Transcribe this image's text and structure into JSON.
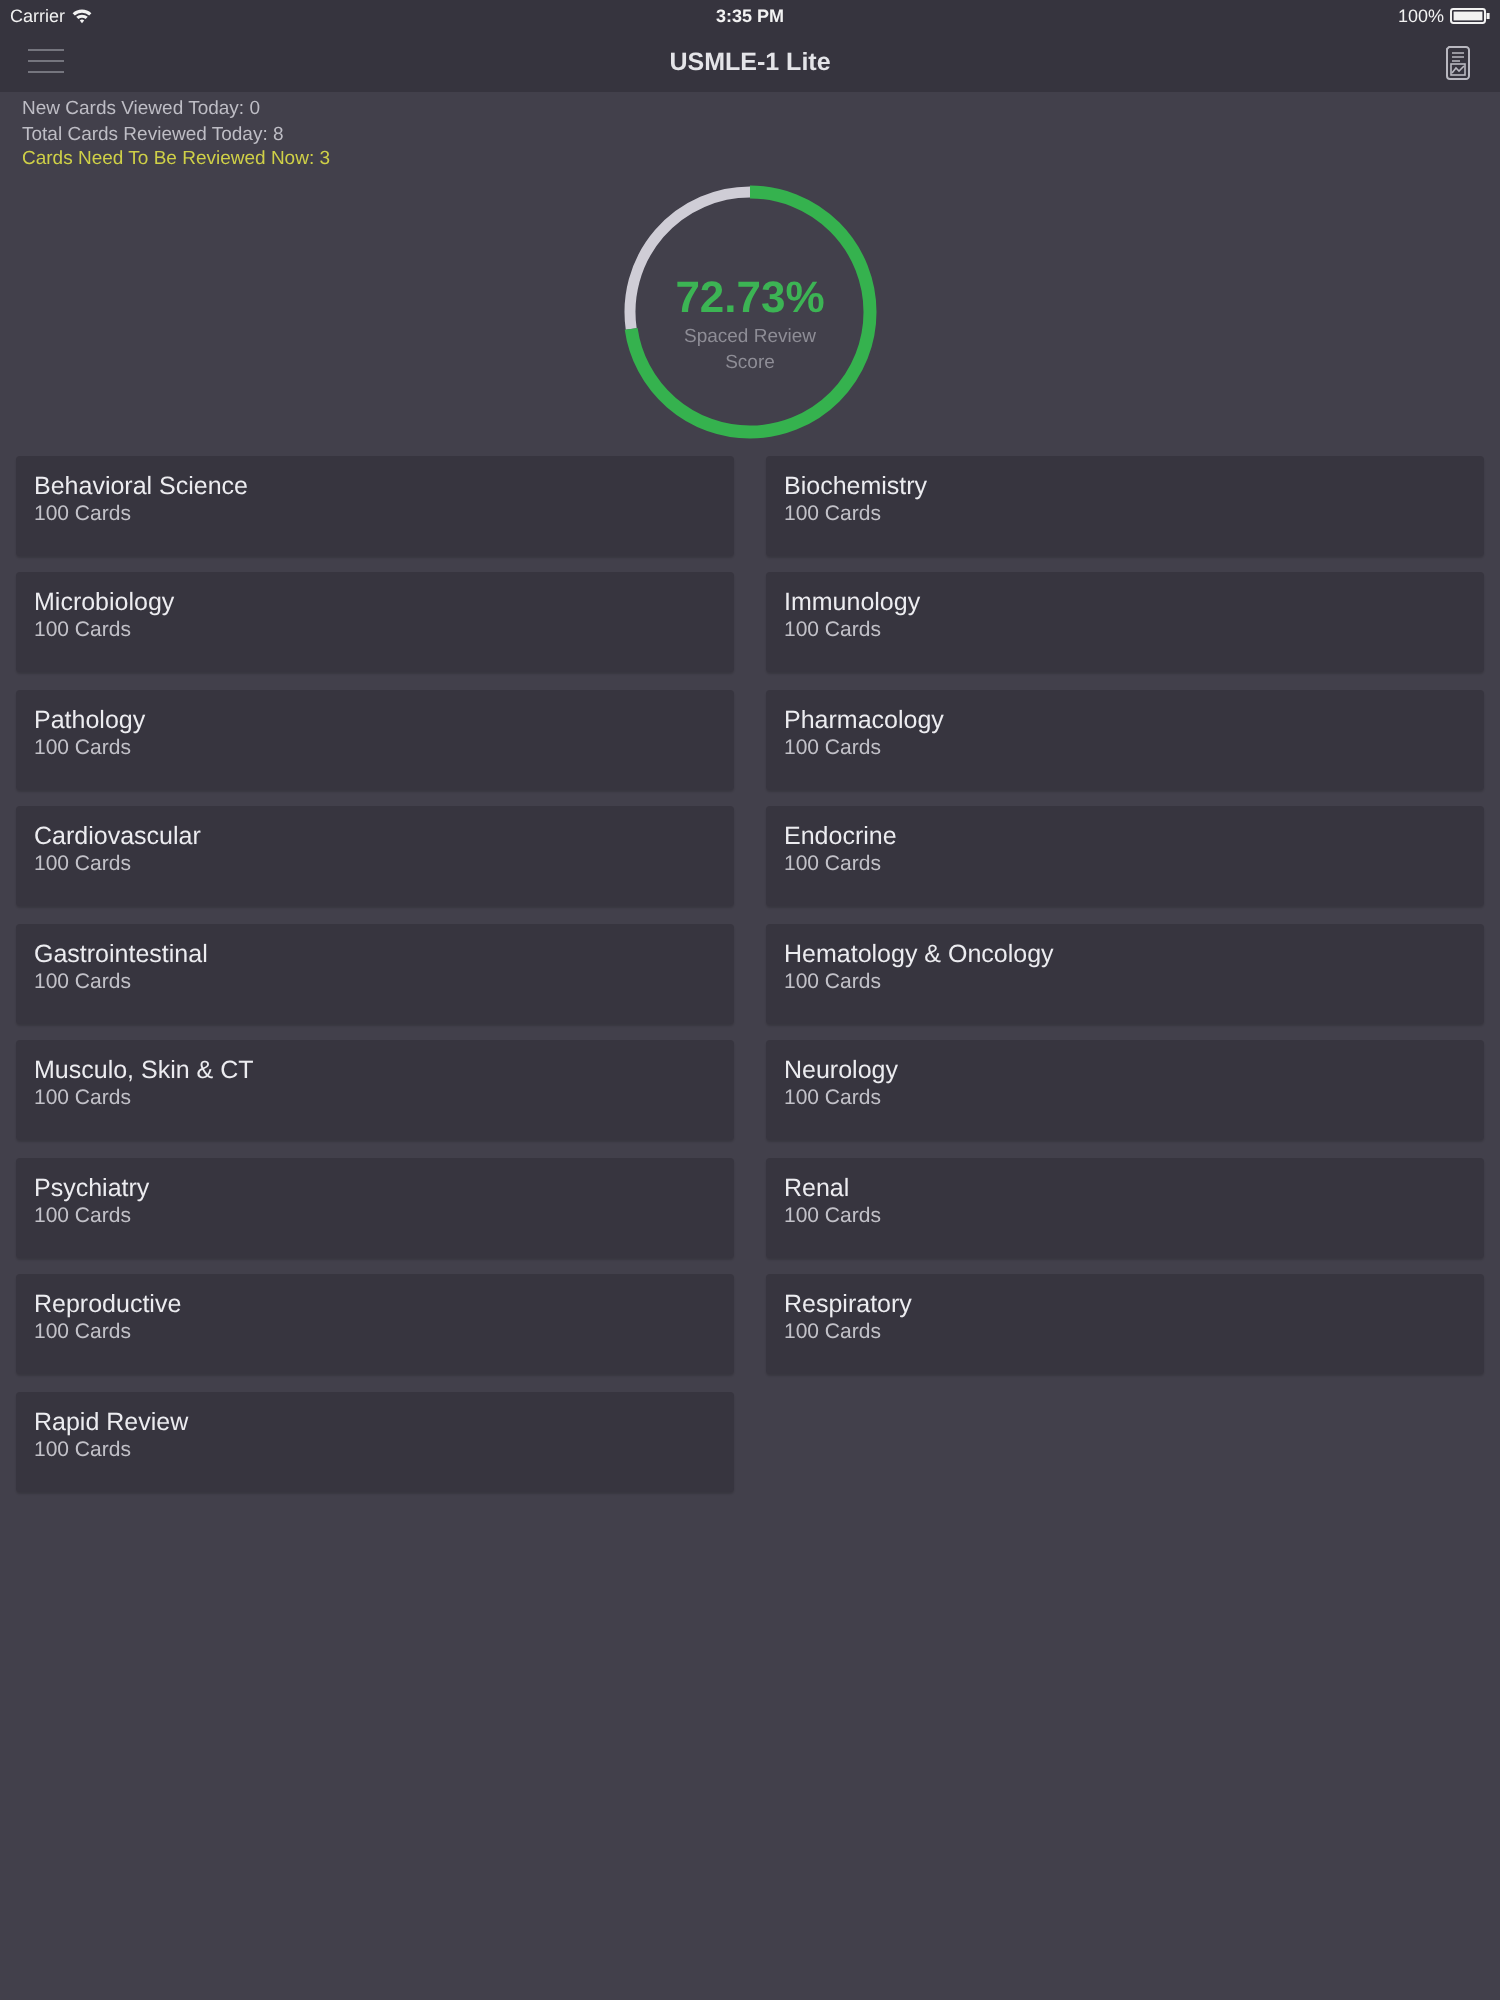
{
  "status_bar": {
    "carrier": "Carrier",
    "time": "3:35 PM",
    "battery": "100%"
  },
  "nav_bar": {
    "title": "USMLE-1 Lite"
  },
  "stats": [
    {
      "text": "New Cards Viewed Today: 0",
      "kind": "normal"
    },
    {
      "text": "Total Cards Reviewed Today: 8",
      "kind": "normal"
    },
    {
      "text": "Cards Need To Be Reviewed Now: 3",
      "kind": "highlight"
    }
  ],
  "score": {
    "value": "72.73%",
    "caption": "Spaced Review Score",
    "level": 0.7273
  },
  "subjects": [
    {
      "name": "Behavioral Science",
      "count": "100 Cards"
    },
    {
      "name": "Biochemistry",
      "count": "100 Cards"
    },
    {
      "name": "Microbiology",
      "count": "100 Cards"
    },
    {
      "name": "Immunology",
      "count": "100 Cards"
    },
    {
      "name": "Pathology",
      "count": "100 Cards"
    },
    {
      "name": "Pharmacology",
      "count": "100 Cards"
    },
    {
      "name": "Cardiovascular",
      "count": "100 Cards"
    },
    {
      "name": "Endocrine",
      "count": "100 Cards"
    },
    {
      "name": "Gastrointestinal",
      "count": "100 Cards"
    },
    {
      "name": "Hematology & Oncology",
      "count": "100 Cards"
    },
    {
      "name": "Musculo, Skin & CT",
      "count": "100 Cards"
    },
    {
      "name": "Neurology",
      "count": "100 Cards"
    },
    {
      "name": "Psychiatry",
      "count": "100 Cards"
    },
    {
      "name": "Renal",
      "count": "100 Cards"
    },
    {
      "name": "Reproductive",
      "count": "100 Cards"
    },
    {
      "name": "Respiratory",
      "count": "100 Cards"
    },
    {
      "name": "Rapid Review",
      "count": "100 Cards"
    }
  ]
}
